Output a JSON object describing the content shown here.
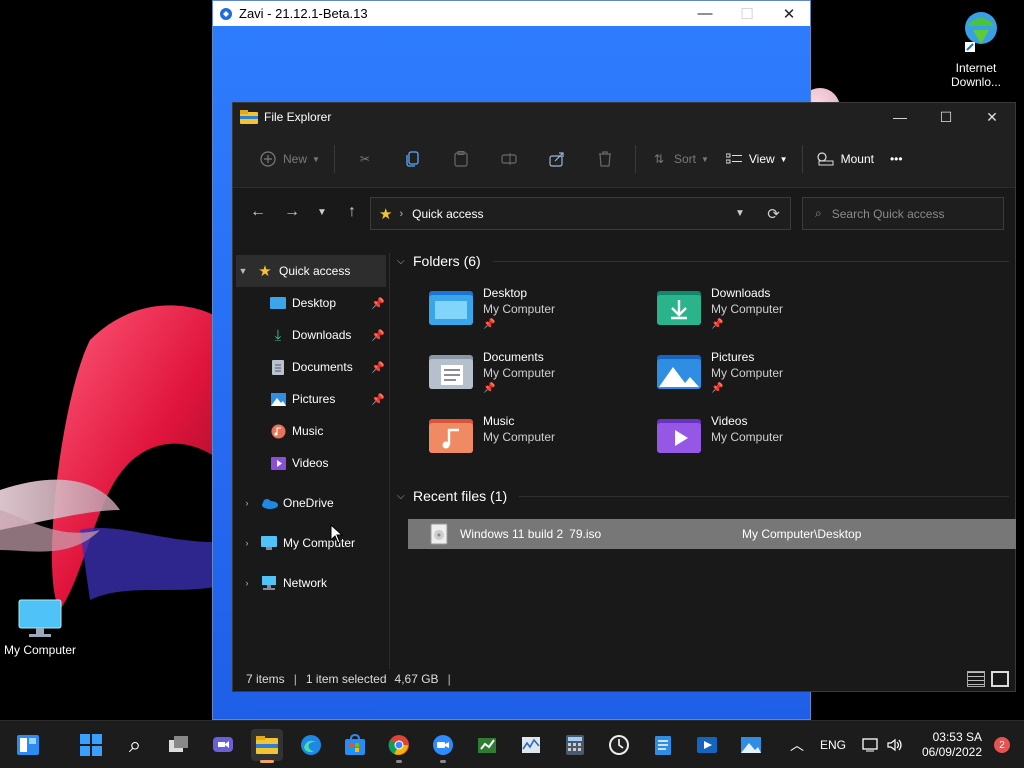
{
  "desktop": {
    "icons": [
      {
        "label": "Internet\nDownlo...",
        "line1": "Internet",
        "line2": "Downlo..."
      },
      {
        "label": "My Computer"
      }
    ]
  },
  "zavi": {
    "title": "Zavi - 21.12.1-Beta.13",
    "controls": {
      "minimize": "—",
      "maximize": "☐",
      "close": "✕"
    }
  },
  "explorer": {
    "title": "File Explorer",
    "window_controls": {
      "minimize": "—",
      "maximize": "☐",
      "close": "✕"
    },
    "commandbar": {
      "new_label": "New",
      "sort_label": "Sort",
      "view_label": "View",
      "mount_label": "Mount",
      "more_label": "•••"
    },
    "address": {
      "location": "Quick access"
    },
    "search": {
      "placeholder": "Search Quick access"
    },
    "nav": {
      "quick_access": "Quick access",
      "items": [
        {
          "label": "Desktop",
          "pinned": true
        },
        {
          "label": "Downloads",
          "pinned": true
        },
        {
          "label": "Documents",
          "pinned": true
        },
        {
          "label": "Pictures",
          "pinned": true
        },
        {
          "label": "Music",
          "pinned": false
        },
        {
          "label": "Videos",
          "pinned": false
        }
      ],
      "onedrive": "OneDrive",
      "my_computer": "My Computer",
      "network": "Network"
    },
    "folders_header": "Folders (6)",
    "folders": [
      {
        "name": "Desktop",
        "location": "My Computer",
        "pinned": true
      },
      {
        "name": "Downloads",
        "location": "My Computer",
        "pinned": true
      },
      {
        "name": "Documents",
        "location": "My Computer",
        "pinned": true
      },
      {
        "name": "Pictures",
        "location": "My Computer",
        "pinned": true
      },
      {
        "name": "Music",
        "location": "My Computer",
        "pinned": false
      },
      {
        "name": "Videos",
        "location": "My Computer",
        "pinned": false
      }
    ],
    "recent_header": "Recent files (1)",
    "recent": [
      {
        "name": "Windows 11 build 2▯79.iso",
        "name_visible": "Windows 11 build 2",
        "name_tail": "79.iso",
        "path": "My Computer\\Desktop"
      }
    ],
    "status": {
      "items": "7 items",
      "selected": "1 item selected",
      "size": "4,67 GB"
    }
  },
  "taskbar": {
    "language": "ENG",
    "time": "03:53 SA",
    "date": "06/09/2022",
    "notifications": "2"
  }
}
